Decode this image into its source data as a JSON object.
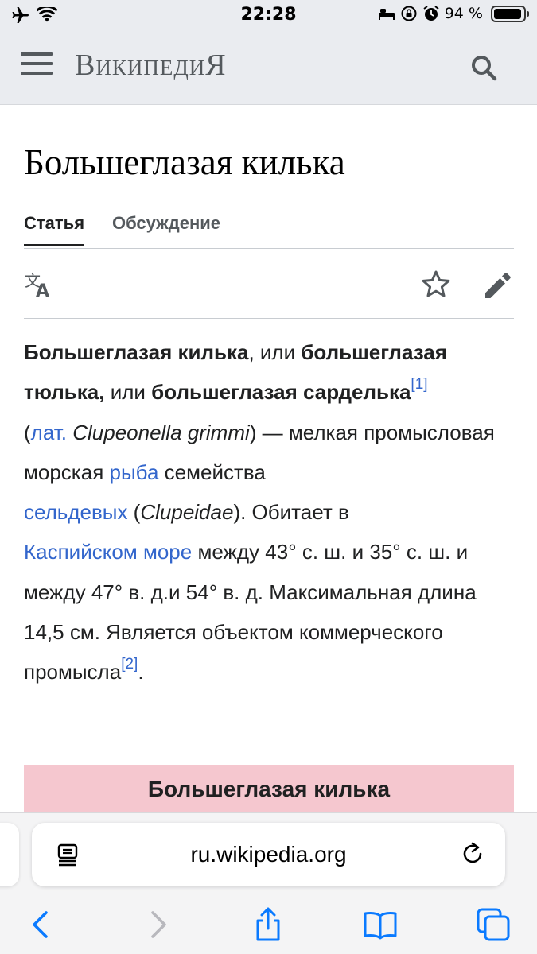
{
  "status_bar": {
    "time": "22:28",
    "battery": "94 %",
    "battery_level": 0.94
  },
  "header": {
    "wordmark": "ВикипедиЯ"
  },
  "title": "Большеглазая килька",
  "tabs": [
    {
      "label": "Статья",
      "active": true
    },
    {
      "label": "Обсуждение",
      "active": false
    }
  ],
  "article": {
    "t1": "Большеглазая килька",
    "t2": ", или ",
    "t3": "большеглазая тюлька,",
    "t4": " или ",
    "t5": "большеглазая сарделька",
    "ref1": "[1]",
    "t6": "(",
    "lat": "лат.",
    "t7": " ",
    "latin_name": "Clupeonella grimmi",
    "t8": ") — мелкая промысловая морская ",
    "fish_link": "рыба",
    "t9": " семейства ",
    "family_link": "сельдевых",
    "t10": " (",
    "family_latin": "Clupeidae",
    "t11": "). Обитает в ",
    "sea_link": "Каспийском море",
    "t12": " между 43° с. ш. и 35° с. ш. и между 47° в. д.и 54° в. д. Максимальная длина 14,5 см. Является объектом коммерческого промысла",
    "ref2": "[2]",
    "t13": "."
  },
  "infobox": {
    "title": "Большеглазая килька"
  },
  "browser": {
    "url": "ru.wikipedia.org"
  },
  "colors": {
    "link": "#3366cc",
    "infobox_bg": "#f5c7cf",
    "header_bg": "#eaecf0",
    "ios_blue": "#0a7aff"
  }
}
